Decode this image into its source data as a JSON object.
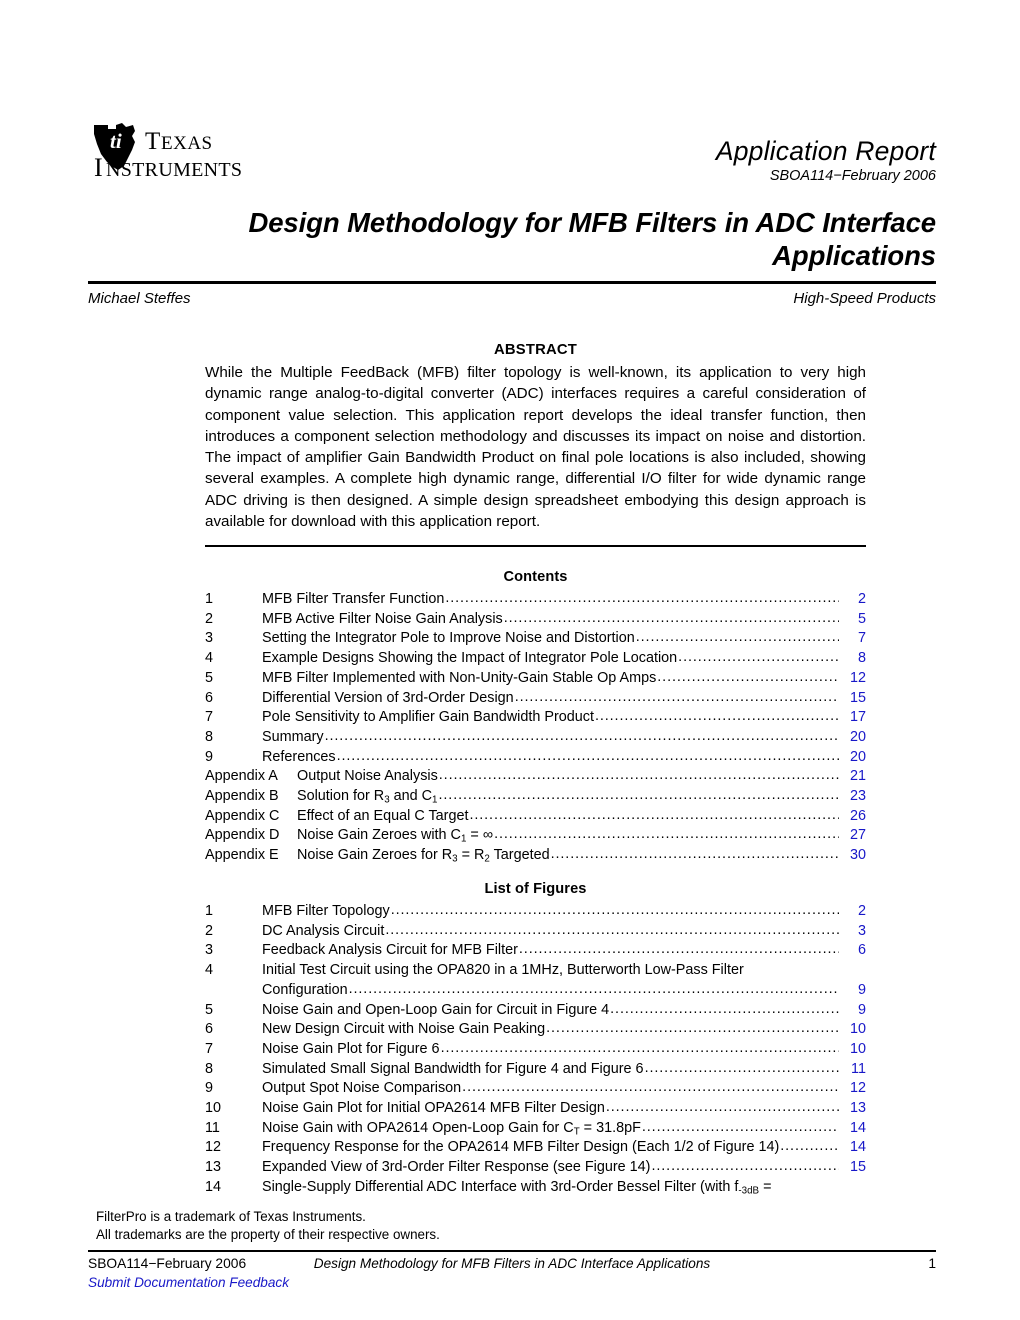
{
  "header": {
    "logo_icon": "ti-logo-icon",
    "logo_text_line1": "TEXAS",
    "logo_text_line2": "INSTRUMENTS",
    "report_type": "Application Report",
    "doc_id": "SBOA114−February 2006"
  },
  "title": {
    "line1": "Design Methodology for MFB Filters in ADC Interface",
    "line2": "Applications",
    "author": "Michael Steffes",
    "division": "High-Speed Products"
  },
  "abstract": {
    "heading": "ABSTRACT",
    "body": "While the Multiple FeedBack (MFB) filter topology is well-known, its application to very high dynamic range analog-to-digital converter (ADC) interfaces requires a careful consideration of component value selection. This application report develops the ideal transfer function, then introduces a component selection methodology and discusses its impact on noise and distortion. The impact of amplifier Gain Bandwidth Product on final pole locations is also included, showing several examples. A complete high dynamic range, differential I/O filter for wide dynamic range ADC driving is then designed. A simple design spreadsheet embodying this design approach is available for download with this application report."
  },
  "contents": {
    "heading": "Contents",
    "entries": [
      {
        "num": "1",
        "label": "MFB Filter Transfer Function",
        "page": "2",
        "dots": true
      },
      {
        "num": "2",
        "label": "MFB Active Filter Noise Gain Analysis ",
        "page": "5",
        "dots": true
      },
      {
        "num": "3",
        "label": "Setting the Integrator Pole to Improve Noise and Distortion",
        "page": "7",
        "dots": true
      },
      {
        "num": "4",
        "label": "Example Designs Showing the Impact of Integrator Pole Location",
        "page": "8",
        "dots": true
      },
      {
        "num": "5",
        "label": "MFB Filter Implemented with Non-Unity-Gain Stable Op Amps  ",
        "page": "12",
        "dots": true
      },
      {
        "num": "6",
        "label": "Differential Version of 3rd-Order Design",
        "page": "15",
        "dots": true
      },
      {
        "num": "7",
        "label": "Pole Sensitivity to Amplifier Gain Bandwidth Product",
        "page": "17",
        "dots": true
      },
      {
        "num": "8",
        "label": "Summary ",
        "page": "20",
        "dots": true
      },
      {
        "num": "9",
        "label": "References",
        "page": "20",
        "dots": true
      },
      {
        "num": "Appendix A",
        "label": "Output Noise Analysis  ",
        "page": "21",
        "dots": true,
        "appendix": true
      },
      {
        "num": "Appendix B",
        "label": "Solution for R<sub>3</sub> and C<sub>1</sub>  ",
        "page": "23",
        "dots": true,
        "appendix": true,
        "html": true
      },
      {
        "num": "Appendix C",
        "label": "Effect of an Equal C Target  ",
        "page": "26",
        "dots": true,
        "appendix": true
      },
      {
        "num": "Appendix D",
        "label": "Noise Gain Zeroes with C<sub>1</sub> = ∞  ",
        "page": "27",
        "dots": true,
        "appendix": true,
        "html": true
      },
      {
        "num": "Appendix E",
        "label": "Noise Gain Zeroes for R<sub>3</sub> = R<sub>2</sub> Targeted  ",
        "page": "30",
        "dots": true,
        "appendix": true,
        "html": true
      }
    ]
  },
  "figures": {
    "heading": "List of Figures",
    "entries": [
      {
        "num": "1",
        "label": "MFB Filter Topology",
        "page": "2",
        "dots": true
      },
      {
        "num": "2",
        "label": "DC Analysis Circuit ",
        "page": "3",
        "dots": true
      },
      {
        "num": "3",
        "label": "Feedback Analysis Circuit for MFB Filter",
        "page": "6",
        "dots": true
      },
      {
        "num": "4",
        "label": "Initial Test Circuit using the OPA820 in a 1MHz, Butterworth Low-Pass Filter",
        "page": "",
        "dots": false
      },
      {
        "num": "",
        "label": "Configuration ",
        "page": "9",
        "dots": true
      },
      {
        "num": "5",
        "label": "Noise Gain and Open-Loop Gain for Circuit in Figure 4 ",
        "page": "9",
        "dots": true
      },
      {
        "num": "6",
        "label": "New Design Circuit with Noise Gain Peaking ",
        "page": "10",
        "dots": true
      },
      {
        "num": "7",
        "label": "Noise Gain Plot for Figure 6 ",
        "page": "10",
        "dots": true
      },
      {
        "num": "8",
        "label": "Simulated Small Signal Bandwidth for Figure 4 and Figure 6",
        "page": "11",
        "dots": true
      },
      {
        "num": "9",
        "label": "Output Spot Noise Comparison ",
        "page": "12",
        "dots": true
      },
      {
        "num": "10",
        "label": "Noise Gain Plot for Initial OPA2614 MFB Filter Design",
        "page": "13",
        "dots": true
      },
      {
        "num": "11",
        "label": "Noise Gain with OPA2614 Open-Loop Gain for C<sub>T</sub> = 31.8pF ",
        "page": "14",
        "dots": true,
        "html": true
      },
      {
        "num": "12",
        "label": "Frequency Response for the OPA2614 MFB Filter Design (Each 1/2 of Figure 14)",
        "page": "14",
        "dots": true
      },
      {
        "num": "13",
        "label": "Expanded View of 3rd-Order Filter Response (see Figure 14) ",
        "page": "15",
        "dots": true
      },
      {
        "num": "14",
        "label": "Single-Supply Differential ADC Interface with 3rd-Order Bessel Filter (with f<sub>-3dB</sub> =",
        "page": "",
        "dots": false,
        "html": true
      }
    ]
  },
  "trademarks": {
    "line1": "FilterPro is a trademark of Texas Instruments.",
    "line2": "All trademarks are the property of their respective owners."
  },
  "footer": {
    "left": "SBOA114−February 2006",
    "center": "Design Methodology for MFB Filters in ADC Interface Applications",
    "page_number": "1",
    "feedback_link": "Submit Documentation Feedback"
  },
  "colors": {
    "link_blue": "#1818c8",
    "text_black": "#000000",
    "background": "#ffffff"
  }
}
